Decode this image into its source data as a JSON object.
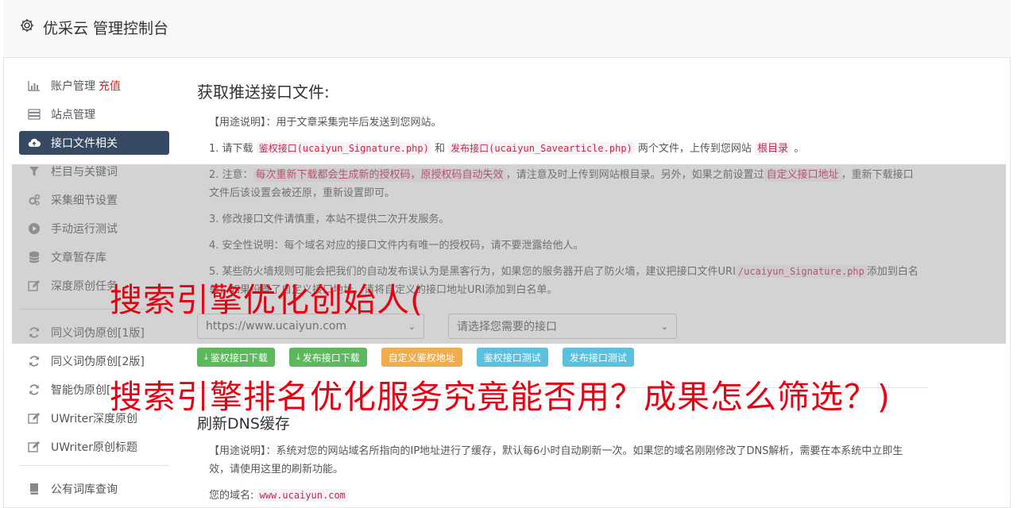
{
  "header": {
    "title": "优采云 管理控制台"
  },
  "sidebar": {
    "items": [
      {
        "label": "账户管理",
        "badge": "充值",
        "icon": "bar-chart-icon"
      },
      {
        "label": "站点管理",
        "icon": "server-icon"
      },
      {
        "label": "接口文件相关",
        "icon": "cloud-upload-icon",
        "active": true
      },
      {
        "label": "栏目与关键词",
        "icon": "filter-icon"
      },
      {
        "label": "采集细节设置",
        "icon": "cogs-icon"
      },
      {
        "label": "手动运行测试",
        "icon": "play-circle-icon"
      },
      {
        "label": "文章暂存库",
        "icon": "database-icon"
      },
      {
        "label": "深度原创任务",
        "icon": "edit-icon"
      }
    ],
    "items2": [
      {
        "label": "同义词伪原创[1版]",
        "icon": "refresh-icon"
      },
      {
        "label": "同义词伪原创[2版]",
        "icon": "refresh-icon"
      },
      {
        "label": "智能伪原创[",
        "icon": "refresh-icon"
      },
      {
        "label": "UWriter深度原创",
        "icon": "edit-icon"
      },
      {
        "label": "UWriter原创标题",
        "icon": "edit-icon"
      }
    ],
    "items3": [
      {
        "label": "公有词库查询",
        "icon": "book-icon"
      }
    ]
  },
  "main": {
    "title": "获取推送接口文件:",
    "usage": "【用途说明】：用于文章采集完毕后发送到您网站。",
    "step1": {
      "a": "1. 请下载",
      "code1": "鉴权接口(ucaiyun_Signature.php)",
      "b": "和",
      "code2": "发布接口(ucaiyun_Savearticle.php)",
      "c": "两个文件，上传到您网站",
      "code3": "根目录",
      "d": "。"
    },
    "step2": {
      "a": "2. 注意：",
      "code1": "每次重新下载都会生成新的授权码，原授权码自动失效",
      "b": "，请注意及时上传到网站根目录。另外，如果之前设置过",
      "code2": "自定义接口地址",
      "c": "，重新下载接口文件后该设置会被还原，重新设置即可。"
    },
    "step3": "3. 修改接口文件请慎重，本站不提供二次开发服务。",
    "step4": "4. 安全性说明：每个域名对应的接口文件内有唯一的授权码，请不要泄露给他人。",
    "step5": {
      "a": "5. 某些防火墙规则可能会把我们的自动发布误认为是黑客行为，如果您的服务器开启了防火墙，建议把接口文件URI",
      "code1": "/ucaiyun_Signature.php",
      "b": "添加到白名单，如果设置了自定义接口地址，请将自定义的接口地址URI添加到白名单。"
    },
    "site_select": "https://www.ucaiyun.com",
    "iface_select": "请选择您需要的接口",
    "buttons": {
      "dl_sign": "鉴权接口下载",
      "dl_publish": "发布接口下载",
      "custom": "自定义鉴权地址",
      "test_sign": "鉴权接口测试",
      "test_publish": "发布接口测试"
    },
    "dns": {
      "title": "刷新DNS缓存",
      "usage": "【用途说明】：系统对您的网站域名所指向的IP地址进行了缓存，默认每6小时自动刷新一次。如果您的域名刚刚修改了DNS解析，需要在本系统中立即生效，请使用这里的刷新功能。",
      "domain_label": "您的域名:",
      "domain": "www.ucaiyun.com"
    }
  },
  "watermark": {
    "line1": "搜索引擎优化创始人(",
    "line2": "搜索引擎排名优化服务究竟能否用？成果怎么筛选？)"
  },
  "colors": {
    "active_nav": "#364a63",
    "green": "#5cb85c",
    "orange": "#f0ad4e",
    "blue": "#5bc0de",
    "watermark": "#e60012"
  }
}
